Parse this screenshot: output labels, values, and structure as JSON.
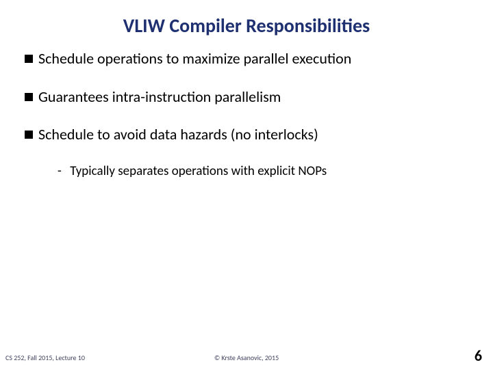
{
  "title": "VLIW Compiler Responsibilities",
  "bullets": {
    "b0": "Schedule operations to maximize parallel execution",
    "b1": "Guarantees intra-instruction parallelism",
    "b2": "Schedule to avoid data hazards (no interlocks)",
    "b2_sub0": "Typically separates operations with explicit NOPs"
  },
  "footer": {
    "left": "CS 252, Fall 2015, Lecture 10",
    "center": "© Krste Asanovic, 2015",
    "pagenum": "6"
  }
}
